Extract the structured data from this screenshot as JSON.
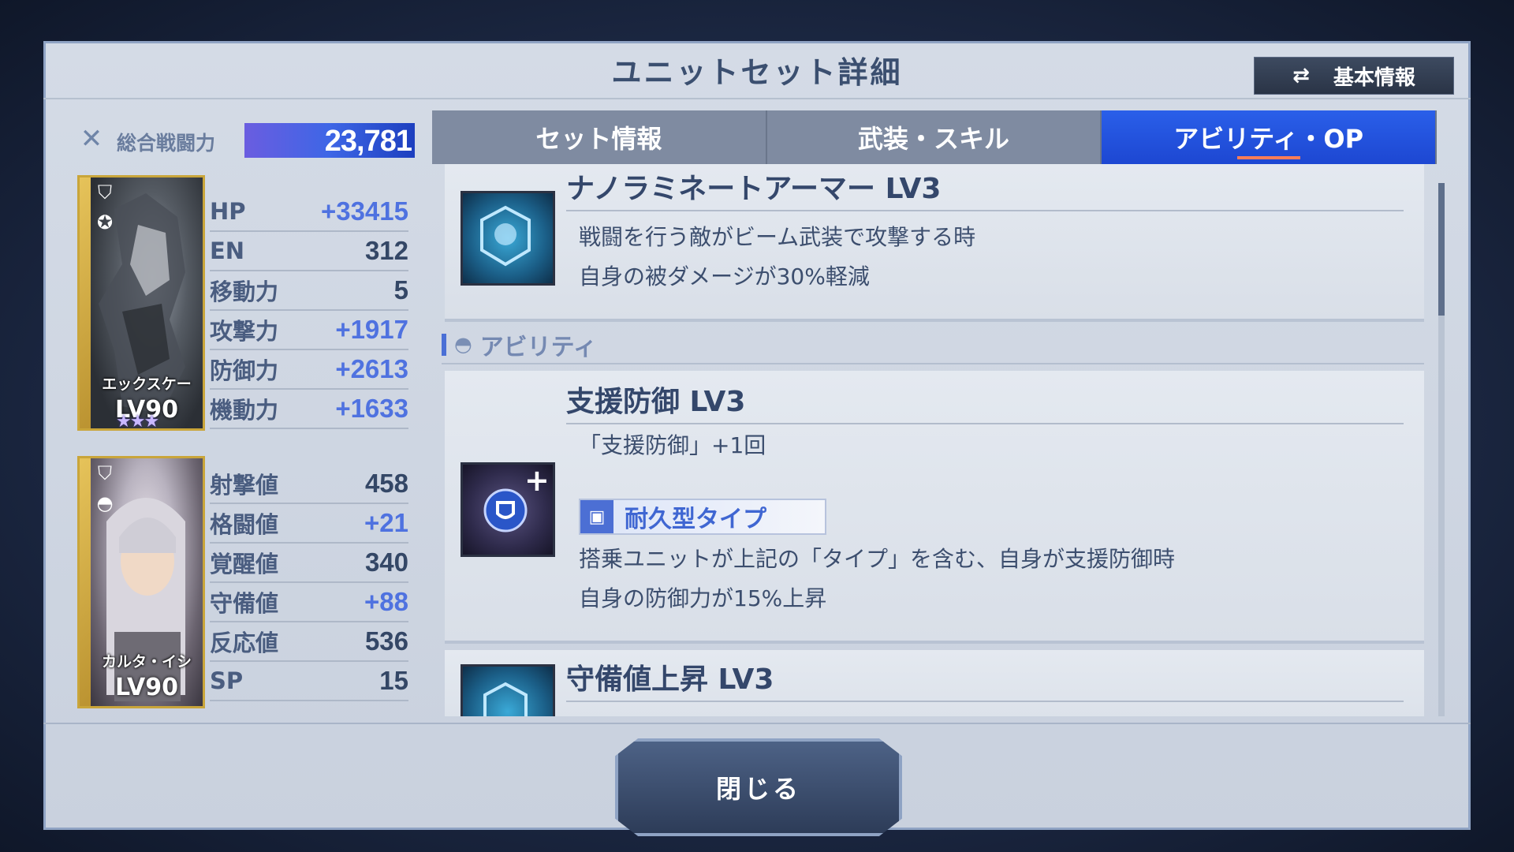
{
  "header": {
    "title": "ユニットセット詳細",
    "basic_info_button": "基本情報"
  },
  "power": {
    "label": "総合戦闘力",
    "value": "23,781"
  },
  "unit_card": {
    "name": "エックスケー",
    "level": "LV90",
    "stars": "★★★"
  },
  "pilot_card": {
    "name": "カルタ・イシ",
    "level": "LV90"
  },
  "unit_stats": [
    {
      "label": "HP",
      "value": "+33415",
      "plus": true
    },
    {
      "label": "EN",
      "value": "312",
      "plus": false
    },
    {
      "label": "移動力",
      "value": "5",
      "plus": false
    },
    {
      "label": "攻撃力",
      "value": "+1917",
      "plus": true
    },
    {
      "label": "防御力",
      "value": "+2613",
      "plus": true
    },
    {
      "label": "機動力",
      "value": "+1633",
      "plus": true
    }
  ],
  "pilot_stats": [
    {
      "label": "射撃値",
      "value": "458",
      "plus": false
    },
    {
      "label": "格闘値",
      "value": "+21",
      "plus": true
    },
    {
      "label": "覚醒値",
      "value": "340",
      "plus": false
    },
    {
      "label": "守備値",
      "value": "+88",
      "plus": true
    },
    {
      "label": "反応値",
      "value": "536",
      "plus": false
    },
    {
      "label": "SP",
      "value": "15",
      "plus": false
    }
  ],
  "tabs": [
    {
      "label": "セット情報",
      "active": false
    },
    {
      "label": "武装・スキル",
      "active": false
    },
    {
      "label": "アビリティ・OP",
      "active": true
    }
  ],
  "skills": {
    "first": {
      "name": "ナノラミネートアーマー LV3",
      "desc1": "戦闘を行う敵がビーム武装で攻撃する時",
      "desc2": "自身の被ダメージが30%軽減"
    },
    "section_label": "アビリティ",
    "second": {
      "name": "支援防御 LV3",
      "desc0": "「支援防御」+1回",
      "type_tag": "耐久型タイプ",
      "desc1": "搭乗ユニットが上記の「タイプ」を含む、自身が支援防御時",
      "desc2": "自身の防御力が15%上昇"
    },
    "third": {
      "name": "守備値上昇 LV3"
    }
  },
  "close_button": "閉じる"
}
